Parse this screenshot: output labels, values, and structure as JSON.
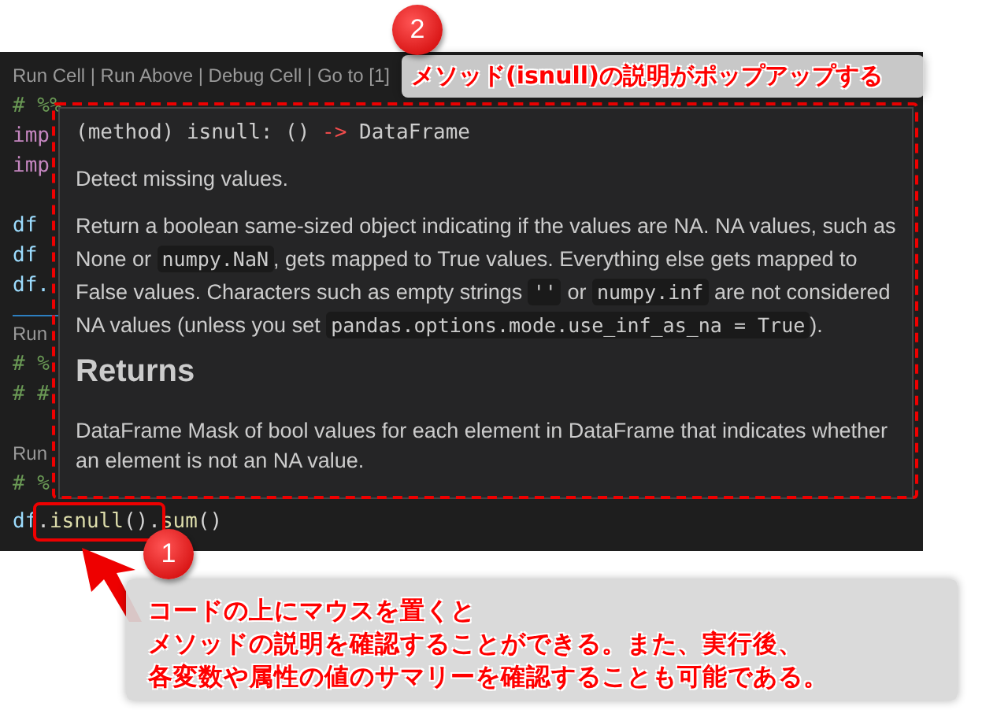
{
  "editor": {
    "lines": [
      {
        "kind": "codelens",
        "tokens": [
          {
            "text": "Run Cell | Run Above | Debug Cell | Go to [1]",
            "kind": "lens"
          }
        ]
      },
      {
        "kind": "code",
        "tokens": [
          {
            "text": "# %%",
            "kind": "comment"
          }
        ]
      },
      {
        "kind": "code",
        "tokens": [
          {
            "text": "imp",
            "kind": "keyword"
          }
        ]
      },
      {
        "kind": "code",
        "tokens": [
          {
            "text": "imp",
            "kind": "keyword"
          }
        ]
      },
      {
        "kind": "blank"
      },
      {
        "kind": "code",
        "tokens": [
          {
            "text": "df",
            "kind": "variable"
          }
        ]
      },
      {
        "kind": "code",
        "tokens": [
          {
            "text": "df",
            "kind": "variable"
          }
        ]
      },
      {
        "kind": "code",
        "tokens": [
          {
            "text": "df.",
            "kind": "variable"
          }
        ]
      },
      {
        "kind": "divider"
      },
      {
        "kind": "codelens",
        "tokens": [
          {
            "text": "Run",
            "kind": "lens"
          }
        ]
      },
      {
        "kind": "code",
        "tokens": [
          {
            "text": "# %",
            "kind": "comment"
          }
        ]
      },
      {
        "kind": "code",
        "tokens": [
          {
            "text": "# #",
            "kind": "comment"
          }
        ]
      },
      {
        "kind": "blank"
      },
      {
        "kind": "codelens",
        "tokens": [
          {
            "text": "Run",
            "kind": "lens"
          }
        ]
      },
      {
        "kind": "code",
        "tokens": [
          {
            "text": "# %",
            "kind": "comment"
          }
        ]
      },
      {
        "kind": "code",
        "tokens": [
          {
            "text": "df",
            "kind": "variable"
          },
          {
            "text": ".",
            "kind": "plain"
          },
          {
            "text": "isnull",
            "kind": "function"
          },
          {
            "text": "().",
            "kind": "plain"
          },
          {
            "text": "sum",
            "kind": "function"
          },
          {
            "text": "()",
            "kind": "plain"
          }
        ]
      }
    ]
  },
  "hover_popup": {
    "signature": [
      {
        "text": "(method) isnull: () ",
        "kind": "plain"
      },
      {
        "text": "->",
        "kind": "arrow"
      },
      {
        "text": " DataFrame",
        "kind": "plain"
      }
    ],
    "summary": "Detect missing values.",
    "description": [
      {
        "text": "Return a boolean same-sized object indicating if the values are NA. NA values, such as None or ",
        "code": false
      },
      {
        "text": "numpy.NaN",
        "code": true
      },
      {
        "text": ", gets mapped to True values. Everything else gets mapped to False values. Characters such as empty strings ",
        "code": false
      },
      {
        "text": "''",
        "code": true
      },
      {
        "text": " or ",
        "code": false
      },
      {
        "text": "numpy.inf",
        "code": true
      },
      {
        "text": " are not considered NA values (unless you set ",
        "code": false
      },
      {
        "text": "pandas.options.mode.use_inf_as_na = True",
        "code": true
      },
      {
        "text": ").",
        "code": false
      }
    ],
    "heading": "Returns",
    "returns": "DataFrame Mask of bool values for each element in DataFrame that indicates whether an element is not an NA value."
  },
  "callouts": [
    {
      "number": "2",
      "lines": [
        "メソッド(isnull)の説明がポップアップする"
      ]
    },
    {
      "number": "1",
      "lines": [
        "コードの上にマウスを置くと",
        "メソッドの説明を確認することができる。また、実行後、",
        "各変数や属性の値のサマリーを確認することも可能である。"
      ]
    }
  ]
}
